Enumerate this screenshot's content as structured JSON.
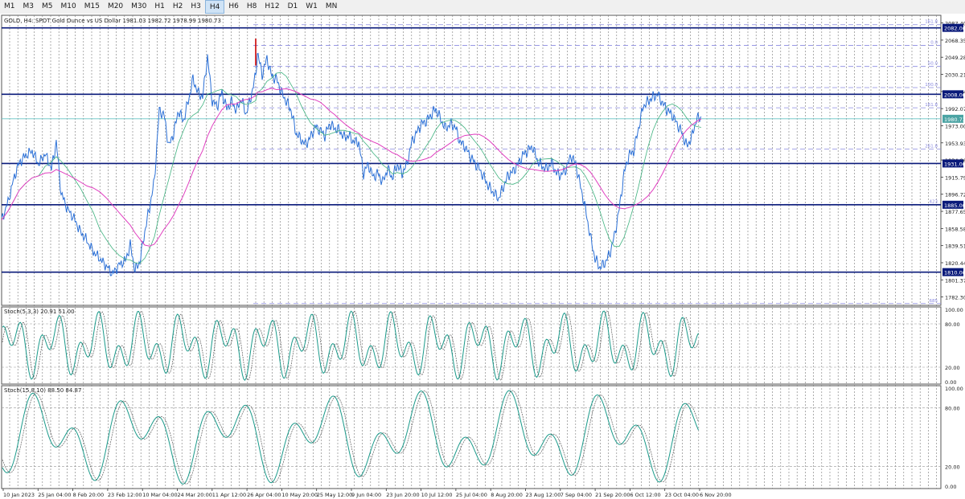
{
  "toolbar": {
    "timeframes": [
      "M1",
      "M3",
      "M5",
      "M10",
      "M15",
      "M20",
      "M30",
      "H1",
      "H2",
      "H3",
      "H4",
      "H6",
      "H8",
      "H12",
      "D1",
      "W1",
      "MN"
    ],
    "active": "H4"
  },
  "colors": {
    "price_line": "#2a6fd6",
    "ma_fast": "#3fb27f",
    "ma_slow": "#e040c0",
    "hline": "#0a1a7a",
    "fibo": "#8a8ae0",
    "stoch_main": "#1a9a8a",
    "stoch_signal": "#444444",
    "grid": "#b8b8b8"
  },
  "chart_data": [
    {
      "type": "line",
      "title": "GOLD, H4:  SPOT Gold Ounce vs US Dollar  1981.03 1982.72 1978.99 1980.73",
      "current_price": "1980.73",
      "y_ticks": [
        "2087.40",
        "2068.35",
        "2049.28",
        "2030.21",
        "2011.14",
        "1992.07",
        "1973.00",
        "1953.93",
        "1934.86",
        "1915.79",
        "1896.72",
        "1877.65",
        "1858.58",
        "1839.51",
        "1820.44",
        "1801.37",
        "1782.30"
      ],
      "x_labels": [
        "10 Jan 2023",
        "25 Jan 04:00",
        "8 Feb 20:00",
        "23 Feb 12:00",
        "10 Mar 04:00",
        "24 Mar 20:00",
        "11 Apr 12:00",
        "26 Apr 04:00",
        "10 May 20:00",
        "25 May 12:00",
        "9 Jun 04:00",
        "23 Jun 20:00",
        "10 Jul 12:00",
        "25 Jul 04:00",
        "8 Aug 20:00",
        "23 Aug 12:00",
        "7 Sep 04:00",
        "21 Sep 20:00",
        "6 Oct 12:00",
        "23 Oct 04:00",
        "6 Nov 20:00"
      ],
      "ylim": [
        1773,
        2096
      ],
      "horizontal_levels": [
        {
          "price": 2082.0,
          "label": "2082.00"
        },
        {
          "price": 2008.0,
          "label": "2008.00"
        },
        {
          "price": 1931.0,
          "label": "1931.00"
        },
        {
          "price": 1885.0,
          "label": "1885.00"
        },
        {
          "price": 1810.0,
          "label": "1810.00"
        }
      ],
      "fibo_levels": [
        {
          "price": 2085.5,
          "label": "161.8"
        },
        {
          "price": 2062.5,
          "label": "0.0"
        },
        {
          "price": 2039.0,
          "label": "50.0"
        },
        {
          "price": 2015.5,
          "label": "100.0"
        },
        {
          "price": 1993.0,
          "label": "161.8"
        },
        {
          "price": 1947.0,
          "label": "261.8"
        },
        {
          "price": 1885.5,
          "label": "423"
        },
        {
          "price": 1775.0,
          "label": "685"
        }
      ],
      "series": [
        {
          "x": [
            0,
            8,
            16,
            22,
            30,
            38,
            46,
            54,
            62,
            68,
            74,
            82,
            90,
            98,
            106,
            114,
            122,
            130,
            138,
            146,
            154,
            160,
            166,
            172,
            178,
            184,
            190,
            196,
            202,
            208,
            214,
            220,
            226,
            232,
            238,
            244,
            250,
            256,
            262,
            268,
            274,
            280,
            286,
            292,
            298,
            304,
            310,
            316,
            318,
            324,
            330,
            336,
            342,
            348,
            354,
            360,
            366,
            372,
            378,
            384,
            390,
            396,
            402,
            408,
            414,
            420,
            426,
            432,
            438,
            444,
            450,
            456,
            462,
            468,
            474,
            480,
            486,
            492,
            498,
            504,
            510,
            516,
            522,
            528,
            534,
            540,
            546,
            552,
            558,
            564,
            570,
            576,
            582,
            588,
            594,
            600,
            606,
            612,
            618,
            624,
            630,
            636,
            642,
            648,
            654,
            660,
            666,
            672,
            678,
            684,
            690,
            696,
            702,
            708,
            714,
            720,
            726,
            732,
            738,
            744,
            750,
            756,
            762,
            768,
            774,
            780,
            786,
            792,
            798,
            804,
            810,
            816,
            822,
            828,
            834,
            840,
            846,
            852,
            858,
            864,
            870
          ],
          "values": [
            1868,
            1888,
            1917,
            1932,
            1940,
            1945,
            1930,
            1942,
            1925,
            1955,
            1898,
            1880,
            1870,
            1855,
            1845,
            1833,
            1825,
            1817,
            1808,
            1818,
            1823,
            1840,
            1812,
            1822,
            1855,
            1882,
            1912,
            1990,
            1985,
            1950,
            1965,
            1990,
            1978,
            2000,
            2025,
            2010,
            2005,
            2050,
            2000,
            1995,
            2010,
            1992,
            2000,
            1990,
            2003,
            1986,
            2005,
            2030,
            2055,
            2030,
            2048,
            2028,
            2025,
            2010,
            2000,
            1990,
            1965,
            1958,
            1952,
            1960,
            1972,
            1968,
            1962,
            1975,
            1970,
            1968,
            1960,
            1962,
            1955,
            1955,
            1920,
            1930,
            1916,
            1920,
            1910,
            1925,
            1915,
            1930,
            1920,
            1930,
            1955,
            1965,
            1975,
            1978,
            1985,
            1992,
            1980,
            1970,
            1975,
            1972,
            1955,
            1950,
            1940,
            1932,
            1925,
            1915,
            1905,
            1898,
            1892,
            1905,
            1918,
            1922,
            1930,
            1940,
            1945,
            1950,
            1935,
            1928,
            1925,
            1932,
            1920,
            1918,
            1925,
            1940,
            1930,
            1905,
            1880,
            1850,
            1825,
            1815,
            1820,
            1830,
            1850,
            1880,
            1920,
            1940,
            1945,
            1970,
            1995,
            2000,
            2005,
            2008,
            1998,
            1990,
            1985,
            1975,
            1965,
            1950,
            1960,
            1980,
            1983
          ],
          "name": "price"
        }
      ]
    },
    {
      "type": "line",
      "title": "Stoch(5,3,3) 20.91 51.00",
      "y_ticks": [
        "100.00",
        "80.00",
        "20.00",
        "0.00"
      ],
      "ylim": [
        0,
        100
      ]
    },
    {
      "type": "line",
      "title": "Stoch(15,8,10) 88.50 84.87",
      "y_ticks": [
        "100.00",
        "80.00",
        "20.00",
        "0.00"
      ],
      "ylim": [
        0,
        100
      ]
    }
  ]
}
